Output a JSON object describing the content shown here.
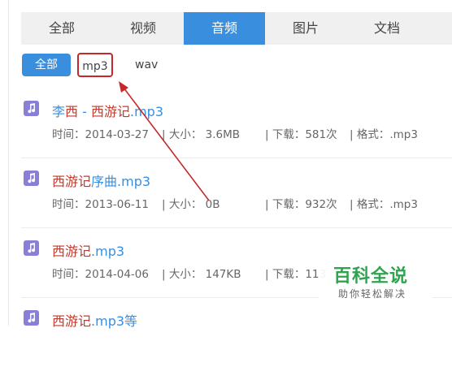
{
  "tabs": [
    {
      "label": "全部"
    },
    {
      "label": "视频"
    },
    {
      "label": "音频",
      "active": true
    },
    {
      "label": "图片"
    },
    {
      "label": "文档"
    }
  ],
  "filters": [
    {
      "label": "全部",
      "active": true
    },
    {
      "label": "mp3",
      "highlighted": true
    },
    {
      "label": "wav"
    }
  ],
  "files": [
    {
      "title_parts": [
        {
          "text": "李"
        },
        {
          "text": "西",
          "hl": true
        },
        {
          "text": " - "
        },
        {
          "text": "西游记",
          "hl": true
        },
        {
          "text": ".mp3"
        }
      ],
      "date": "时间：2014-03-27",
      "size": "| 大小： 3.6MB",
      "downloads": "|    下载：581次",
      "format": "|    格式：.mp3",
      "icon": "music-file-icon"
    },
    {
      "title_parts": [
        {
          "text": "西游记",
          "hl": true
        },
        {
          "text": "序曲.mp3"
        }
      ],
      "date": "时间：2013-06-11",
      "size": "|    大小： 0B",
      "downloads": "|    下载：932次",
      "format": "|    格式：.mp3",
      "icon": "music-file-icon"
    },
    {
      "title_parts": [
        {
          "text": "西游记",
          "hl": true
        },
        {
          "text": ".mp3"
        }
      ],
      "date": "时间：2014-04-06",
      "size": "| 大小： 147KB",
      "downloads": "|    下载：113",
      "format": "",
      "icon": "music-file-icon"
    },
    {
      "title_parts": [
        {
          "text": "西游记",
          "hl": true
        },
        {
          "text": ".mp3等"
        }
      ],
      "date": "",
      "size": "",
      "downloads": "",
      "format": "",
      "icon": "music-file-icon"
    }
  ],
  "watermark": {
    "title": "百科全说",
    "subtitle": "助你轻松解决"
  },
  "colors": {
    "accent": "#3a8ede",
    "highlight": "#c0392b",
    "annotation": "#c62828",
    "watermark": "#2fa44f"
  }
}
